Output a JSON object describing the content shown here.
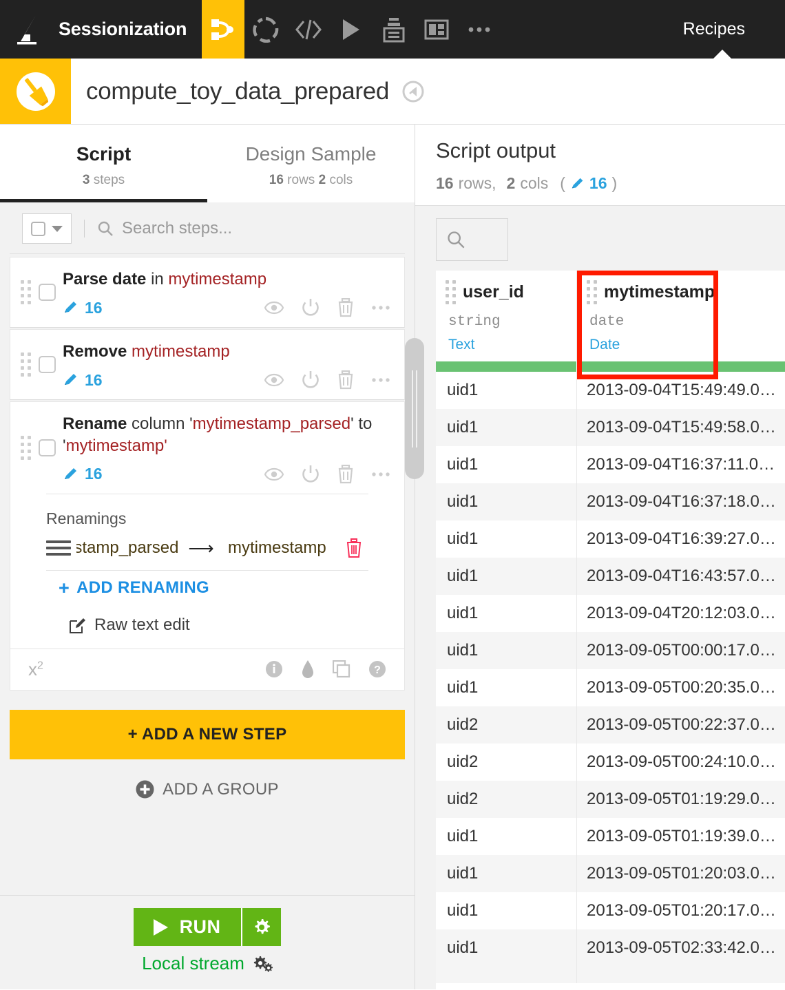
{
  "topnav": {
    "project_name": "Sessionization",
    "logo_icon": "dataiku-logo-icon",
    "icons": [
      {
        "name": "flow-icon",
        "active": true
      },
      {
        "name": "lab-circle-icon",
        "active": false
      },
      {
        "name": "code-icon",
        "active": false
      },
      {
        "name": "play-icon",
        "active": false
      },
      {
        "name": "jobs-stack-icon",
        "active": false
      },
      {
        "name": "dashboard-layout-icon",
        "active": false
      },
      {
        "name": "more-ellipsis-icon",
        "active": false
      }
    ],
    "tab_label": "Recipes"
  },
  "recipe_header": {
    "badge_icon": "broom-prepare-recipe-icon",
    "title": "compute_toy_data_prepared",
    "compass_icon": "compass-icon"
  },
  "left_panel": {
    "tabs": [
      {
        "title": "Script",
        "sub_num": "3",
        "sub_text": "steps",
        "active": true
      },
      {
        "title": "Design Sample",
        "sub_num": "16",
        "sub_text": "rows",
        "sub_num2": "2",
        "sub_text2": "cols",
        "active": false
      }
    ],
    "toolbar": {
      "select_all_icon": "checkbox-dropdown",
      "search_icon": "search-icon",
      "search_placeholder": "Search steps..."
    },
    "steps": [
      {
        "verb": "Parse date",
        "mid": " in ",
        "column": "mytimestamp",
        "suffix": "",
        "count": "16",
        "count_icon": "pencil-icon",
        "actions": [
          "eye-icon",
          "power-icon",
          "trash-icon",
          "ellipsis-icon"
        ]
      },
      {
        "verb": "Remove",
        "mid": " ",
        "column": "mytimestamp",
        "suffix": "",
        "count": "16",
        "count_icon": "pencil-icon",
        "actions": [
          "eye-icon",
          "power-icon",
          "trash-icon",
          "ellipsis-icon"
        ]
      },
      {
        "verb": "Rename",
        "mid": " column '",
        "column": "mytimestamp_parsed",
        "suffix": "' to '",
        "column2": "mytimestamp",
        "suffix2": "'",
        "count": "16",
        "count_icon": "pencil-icon",
        "actions": [
          "eye-icon",
          "power-icon",
          "trash-icon",
          "ellipsis-icon"
        ]
      }
    ],
    "expanded_step": {
      "section_label": "Renamings",
      "rename_row": {
        "handle_icon": "drag-handle-icon",
        "from_value": "mytimestamp_parsed",
        "arrow_icon": "arrow-right-icon",
        "to_value": "mytimestamp",
        "delete_icon": "trash-icon"
      },
      "add_renaming_label": "ADD RENAMING",
      "add_renaming_plus": "+",
      "raw_text_edit_label": "Raw text edit",
      "raw_text_edit_icon": "edit-square-icon",
      "footer_formula": "x",
      "footer_formula_exp": "2",
      "footer_icons": [
        "info-icon",
        "droplet-icon",
        "copy-icon",
        "help-icon"
      ]
    },
    "add_step_label": "+ ADD A NEW STEP",
    "add_group_label": "ADD A GROUP",
    "add_group_icon": "plus-circle-icon",
    "run_button": {
      "label": "RUN",
      "play_icon": "play-icon",
      "settings_icon": "gear-icon"
    },
    "engine_label": "Local stream",
    "engine_icon": "gears-icon",
    "splitter_name": "pane-splitter-handle"
  },
  "right_panel": {
    "title": "Script output",
    "rows_num": "16",
    "rows_label": "rows,",
    "cols_num": "2",
    "cols_label": "cols",
    "edit_open": "(",
    "edit_icon": "pencil-icon",
    "edit_count": "16",
    "edit_close": ")",
    "search_icon": "search-icon",
    "columns": [
      {
        "name": "user_id",
        "storage_type": "string",
        "meaning": "Text",
        "highlighted": false,
        "grip_icon": "column-grip-icon"
      },
      {
        "name": "mytimestamp",
        "storage_type": "date",
        "meaning": "Date",
        "highlighted": true,
        "grip_icon": "column-grip-icon"
      }
    ],
    "highlight_color": "#FF1A00",
    "progress_bar_color": "#69C272",
    "rows": [
      {
        "user_id": "uid1",
        "mytimestamp": "2013-09-04T15:49:49.0…"
      },
      {
        "user_id": "uid1",
        "mytimestamp": "2013-09-04T15:49:58.0…"
      },
      {
        "user_id": "uid1",
        "mytimestamp": "2013-09-04T16:37:11.0…"
      },
      {
        "user_id": "uid1",
        "mytimestamp": "2013-09-04T16:37:18.0…"
      },
      {
        "user_id": "uid1",
        "mytimestamp": "2013-09-04T16:39:27.0…"
      },
      {
        "user_id": "uid1",
        "mytimestamp": "2013-09-04T16:43:57.0…"
      },
      {
        "user_id": "uid1",
        "mytimestamp": "2013-09-04T20:12:03.0…"
      },
      {
        "user_id": "uid1",
        "mytimestamp": "2013-09-05T00:00:17.0…"
      },
      {
        "user_id": "uid1",
        "mytimestamp": "2013-09-05T00:20:35.0…"
      },
      {
        "user_id": "uid2",
        "mytimestamp": "2013-09-05T00:22:37.0…"
      },
      {
        "user_id": "uid2",
        "mytimestamp": "2013-09-05T00:24:10.0…"
      },
      {
        "user_id": "uid2",
        "mytimestamp": "2013-09-05T01:19:29.0…"
      },
      {
        "user_id": "uid1",
        "mytimestamp": "2013-09-05T01:19:39.0…"
      },
      {
        "user_id": "uid1",
        "mytimestamp": "2013-09-05T01:20:03.0…"
      },
      {
        "user_id": "uid1",
        "mytimestamp": "2013-09-05T01:20:17.0…"
      },
      {
        "user_id": "uid1",
        "mytimestamp": "2013-09-05T02:33:42.0…"
      }
    ]
  },
  "colors": {
    "accent_orange": "#FFC107",
    "nav_dark": "#222222",
    "link_blue": "#2AA2DE",
    "column_red": "#A42224",
    "run_green": "#62B515",
    "engine_green": "#00A82D",
    "highlight_red": "#FF1A00"
  }
}
